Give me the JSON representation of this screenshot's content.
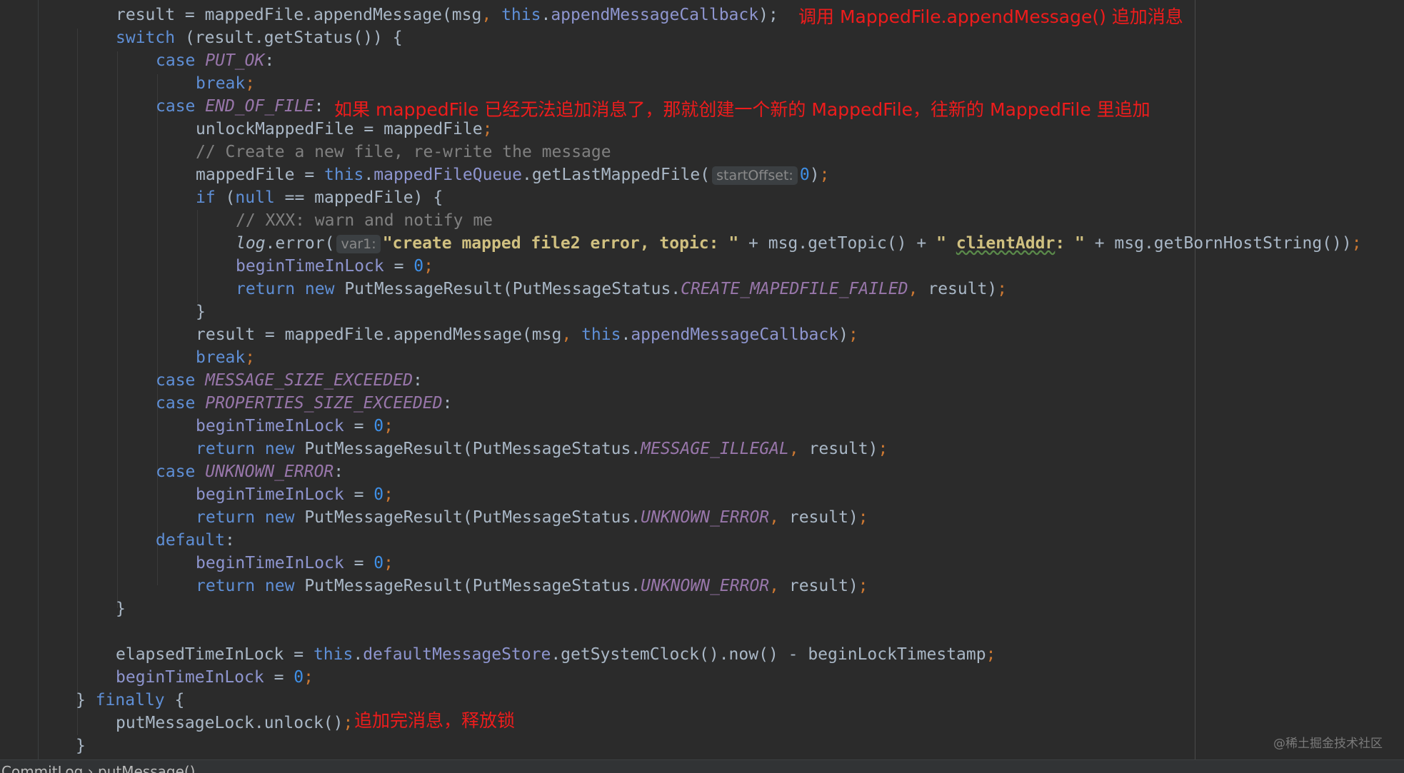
{
  "editor": {
    "lines": [
      {
        "tokens": [
          {
            "t": "result = mappedFile.appendMessage(msg",
            "c": ""
          },
          {
            "t": ", ",
            "c": "kw"
          },
          {
            "t": "this",
            "c": "kw2"
          },
          {
            "t": ".",
            "c": ""
          },
          {
            "t": "appendMessageCallback",
            "c": "fld"
          },
          {
            "t": ");",
            "c": ""
          }
        ]
      },
      {
        "tokens": [
          {
            "t": "switch",
            "c": "kw2"
          },
          {
            "t": " (result.getStatus()) {",
            "c": ""
          }
        ]
      },
      {
        "tokens": [
          {
            "t": "case ",
            "c": "kw2"
          },
          {
            "t": "PUT_OK",
            "c": "cst"
          },
          {
            "t": ":",
            "c": ""
          }
        ]
      },
      {
        "tokens": [
          {
            "t": "break",
            "c": "kw2"
          },
          {
            "t": ";",
            "c": "kw"
          }
        ]
      },
      {
        "tokens": [
          {
            "t": "case ",
            "c": "kw2"
          },
          {
            "t": "END_OF_FILE",
            "c": "cst"
          },
          {
            "t": ":",
            "c": ""
          }
        ]
      },
      {
        "tokens": [
          {
            "t": "unlockMappedFile = mappedFile",
            "c": ""
          },
          {
            "t": ";",
            "c": "kw"
          }
        ]
      },
      {
        "tokens": [
          {
            "t": "// Create a new file, re-write the message",
            "c": "cmt"
          }
        ]
      },
      {
        "tokens": [
          {
            "t": "mappedFile = ",
            "c": ""
          },
          {
            "t": "this",
            "c": "kw2"
          },
          {
            "t": ".",
            "c": ""
          },
          {
            "t": "mappedFileQueue",
            "c": "fld"
          },
          {
            "t": ".getLastMappedFile(",
            "c": ""
          },
          {
            "t": "startOffset:",
            "c": "hint"
          },
          {
            "t": "0",
            "c": "num2"
          },
          {
            "t": ")",
            "c": ""
          },
          {
            "t": ";",
            "c": "kw"
          }
        ]
      },
      {
        "tokens": [
          {
            "t": "if",
            "c": "kw2"
          },
          {
            "t": " (",
            "c": ""
          },
          {
            "t": "null",
            "c": "kw2"
          },
          {
            "t": " == mappedFile) {",
            "c": ""
          }
        ]
      },
      {
        "tokens": [
          {
            "t": "// XXX: warn and notify me",
            "c": "cmt"
          }
        ]
      },
      {
        "tokens": [
          {
            "t": "log",
            "c": "itl"
          },
          {
            "t": ".error(",
            "c": ""
          },
          {
            "t": "var1:",
            "c": "hint"
          },
          {
            "t": "\"create mapped file2 error, topic: \"",
            "c": "str"
          },
          {
            "t": " + msg.getTopic() + ",
            "c": ""
          },
          {
            "t": "\" ",
            "c": "str"
          },
          {
            "t": "clientAddr",
            "c": "str squiggle"
          },
          {
            "t": ": \"",
            "c": "str"
          },
          {
            "t": " + msg.getBornHostString())",
            "c": ""
          },
          {
            "t": ";",
            "c": "kw"
          }
        ]
      },
      {
        "tokens": [
          {
            "t": "beginTimeInLock",
            "c": "fld"
          },
          {
            "t": " = ",
            "c": ""
          },
          {
            "t": "0",
            "c": "num2"
          },
          {
            "t": ";",
            "c": "kw"
          }
        ]
      },
      {
        "tokens": [
          {
            "t": "return new ",
            "c": "kw2"
          },
          {
            "t": "PutMessageResult(PutMessageStatus.",
            "c": ""
          },
          {
            "t": "CREATE_MAPEDFILE_FAILED",
            "c": "cst"
          },
          {
            "t": ", ",
            "c": "kw"
          },
          {
            "t": "result)",
            "c": ""
          },
          {
            "t": ";",
            "c": "kw"
          }
        ]
      },
      {
        "tokens": [
          {
            "t": "}",
            "c": ""
          }
        ]
      },
      {
        "tokens": [
          {
            "t": "result = mappedFile.appendMessage(msg",
            "c": ""
          },
          {
            "t": ", ",
            "c": "kw"
          },
          {
            "t": "this",
            "c": "kw2"
          },
          {
            "t": ".",
            "c": ""
          },
          {
            "t": "appendMessageCallback",
            "c": "fld"
          },
          {
            "t": ")",
            "c": ""
          },
          {
            "t": ";",
            "c": "kw"
          }
        ]
      },
      {
        "tokens": [
          {
            "t": "break",
            "c": "kw2"
          },
          {
            "t": ";",
            "c": "kw"
          }
        ]
      },
      {
        "tokens": [
          {
            "t": "case ",
            "c": "kw2"
          },
          {
            "t": "MESSAGE_SIZE_EXCEEDED",
            "c": "cst"
          },
          {
            "t": ":",
            "c": ""
          }
        ]
      },
      {
        "tokens": [
          {
            "t": "case ",
            "c": "kw2"
          },
          {
            "t": "PROPERTIES_SIZE_EXCEEDED",
            "c": "cst"
          },
          {
            "t": ":",
            "c": ""
          }
        ]
      },
      {
        "tokens": [
          {
            "t": "beginTimeInLock",
            "c": "fld"
          },
          {
            "t": " = ",
            "c": ""
          },
          {
            "t": "0",
            "c": "num2"
          },
          {
            "t": ";",
            "c": "kw"
          }
        ]
      },
      {
        "tokens": [
          {
            "t": "return new ",
            "c": "kw2"
          },
          {
            "t": "PutMessageResult(PutMessageStatus.",
            "c": ""
          },
          {
            "t": "MESSAGE_ILLEGAL",
            "c": "cst"
          },
          {
            "t": ", ",
            "c": "kw"
          },
          {
            "t": "result)",
            "c": ""
          },
          {
            "t": ";",
            "c": "kw"
          }
        ]
      },
      {
        "tokens": [
          {
            "t": "case ",
            "c": "kw2"
          },
          {
            "t": "UNKNOWN_ERROR",
            "c": "cst"
          },
          {
            "t": ":",
            "c": ""
          }
        ]
      },
      {
        "tokens": [
          {
            "t": "beginTimeInLock",
            "c": "fld"
          },
          {
            "t": " = ",
            "c": ""
          },
          {
            "t": "0",
            "c": "num2"
          },
          {
            "t": ";",
            "c": "kw"
          }
        ]
      },
      {
        "tokens": [
          {
            "t": "return new ",
            "c": "kw2"
          },
          {
            "t": "PutMessageResult(PutMessageStatus.",
            "c": ""
          },
          {
            "t": "UNKNOWN_ERROR",
            "c": "cst"
          },
          {
            "t": ", ",
            "c": "kw"
          },
          {
            "t": "result)",
            "c": ""
          },
          {
            "t": ";",
            "c": "kw"
          }
        ]
      },
      {
        "tokens": [
          {
            "t": "default",
            "c": "kw2"
          },
          {
            "t": ":",
            "c": ""
          }
        ]
      },
      {
        "tokens": [
          {
            "t": "beginTimeInLock",
            "c": "fld"
          },
          {
            "t": " = ",
            "c": ""
          },
          {
            "t": "0",
            "c": "num2"
          },
          {
            "t": ";",
            "c": "kw"
          }
        ]
      },
      {
        "tokens": [
          {
            "t": "return new ",
            "c": "kw2"
          },
          {
            "t": "PutMessageResult(PutMessageStatus.",
            "c": ""
          },
          {
            "t": "UNKNOWN_ERROR",
            "c": "cst"
          },
          {
            "t": ", ",
            "c": "kw"
          },
          {
            "t": "result)",
            "c": ""
          },
          {
            "t": ";",
            "c": "kw"
          }
        ]
      },
      {
        "tokens": [
          {
            "t": "}",
            "c": ""
          }
        ]
      },
      {
        "tokens": []
      },
      {
        "tokens": [
          {
            "t": "elapsedTimeInLock = ",
            "c": ""
          },
          {
            "t": "this",
            "c": "kw2"
          },
          {
            "t": ".",
            "c": ""
          },
          {
            "t": "defaultMessageStore",
            "c": "fld"
          },
          {
            "t": ".getSystemClock().now() - beginLockTimestamp",
            "c": ""
          },
          {
            "t": ";",
            "c": "kw"
          }
        ]
      },
      {
        "tokens": [
          {
            "t": "beginTimeInLock",
            "c": "fld"
          },
          {
            "t": " = ",
            "c": ""
          },
          {
            "t": "0",
            "c": "num2"
          },
          {
            "t": ";",
            "c": "kw"
          }
        ]
      },
      {
        "tokens": [
          {
            "t": "} ",
            "c": ""
          },
          {
            "t": "finally",
            "c": "kw2"
          },
          {
            "t": " {",
            "c": ""
          }
        ]
      },
      {
        "tokens": [
          {
            "t": "putMessageLock.unlock()",
            "c": ""
          },
          {
            "t": ";",
            "c": "kw"
          }
        ]
      },
      {
        "tokens": [
          {
            "t": "}",
            "c": ""
          }
        ]
      }
    ]
  },
  "annotations": {
    "append_call": "调用 MappedFile.appendMessage() 追加消息",
    "end_of_file": "如果 mappedFile 已经无法追加消息了，那就创建一个新的 MappedFile，往新的 MappedFile 里追加",
    "unlock": "追加完消息，释放锁"
  },
  "watermark": "@稀土掘金技术社区",
  "status_bar": {
    "text": "CommitLog › putMessage()"
  }
}
